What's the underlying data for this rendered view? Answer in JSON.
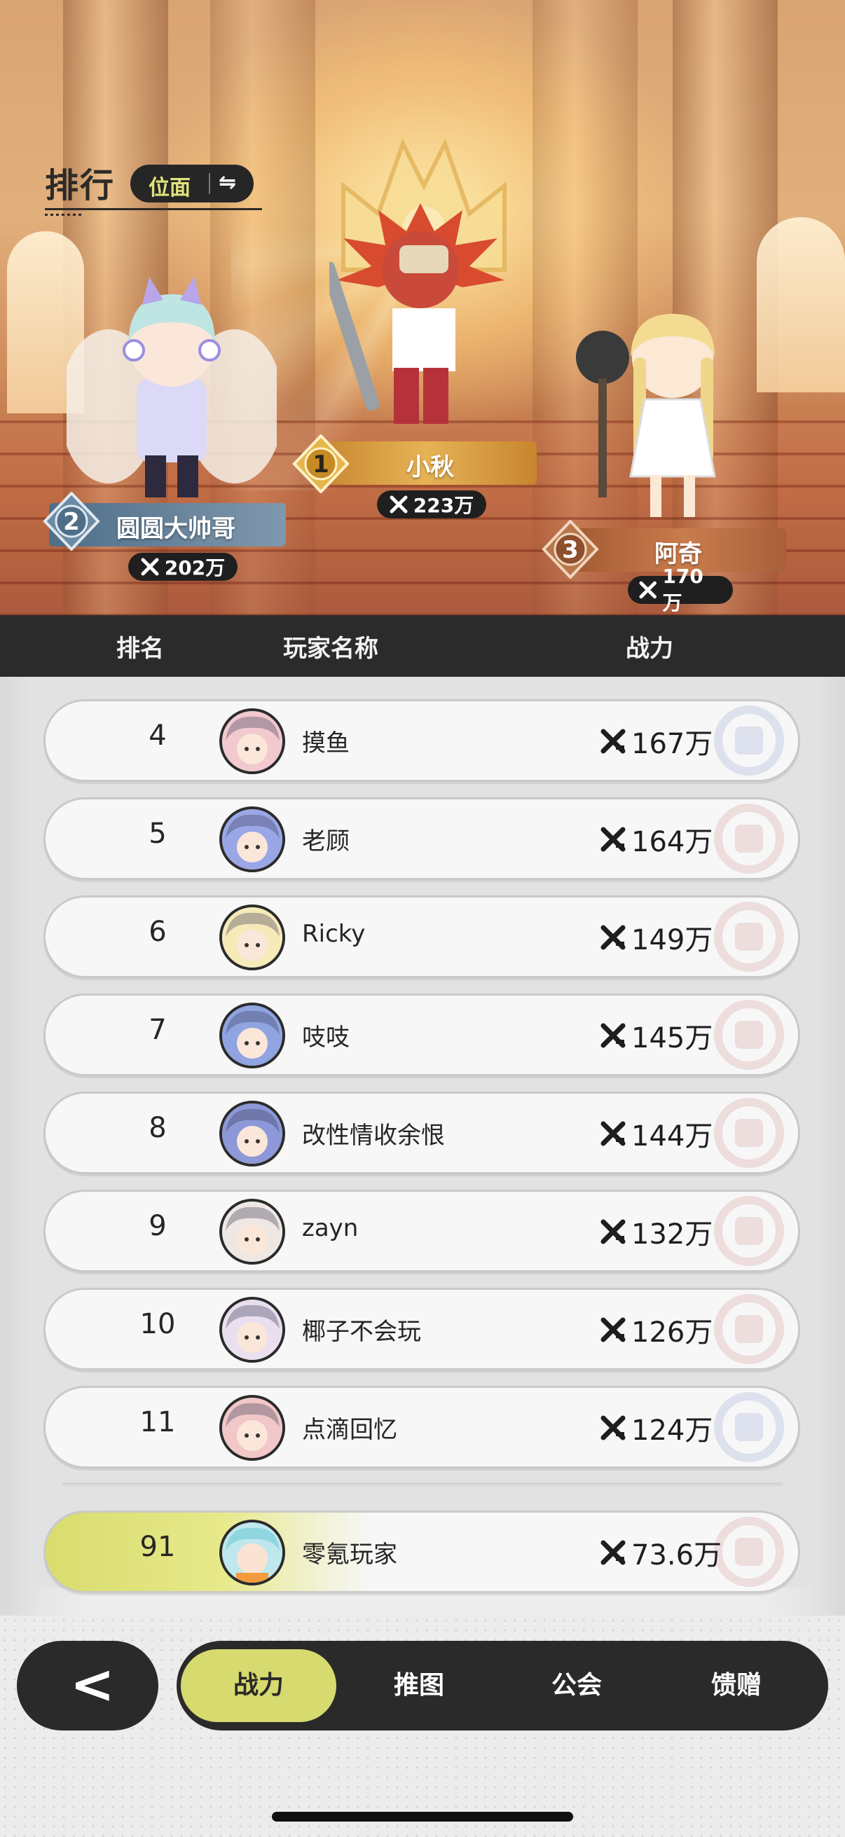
{
  "header": {
    "title": "排行",
    "switch_label": "位面",
    "switch_icon": "swap-icon"
  },
  "podium": [
    {
      "rank": "1",
      "name": "小秋",
      "power": "223万"
    },
    {
      "rank": "2",
      "name": "圆圆大帅哥",
      "power": "202万"
    },
    {
      "rank": "3",
      "name": "阿奇",
      "power": "170万"
    }
  ],
  "table": {
    "columns": [
      "排名",
      "玩家名称",
      "战力"
    ],
    "rows": [
      {
        "rank": "4",
        "name": "摸鱼",
        "power": "167万",
        "avatar_color": "#f1c9cf"
      },
      {
        "rank": "5",
        "name": "老顾",
        "power": "164万",
        "avatar_color": "#9aa7e6"
      },
      {
        "rank": "6",
        "name": "Ricky",
        "power": "149万",
        "avatar_color": "#f6eab9"
      },
      {
        "rank": "7",
        "name": "吱吱",
        "power": "145万",
        "avatar_color": "#8fa4e0"
      },
      {
        "rank": "8",
        "name": "改性情收余恨",
        "power": "144万",
        "avatar_color": "#8d98d8"
      },
      {
        "rank": "9",
        "name": "zayn",
        "power": "132万",
        "avatar_color": "#efe7e3"
      },
      {
        "rank": "10",
        "name": "椰子不会玩",
        "power": "126万",
        "avatar_color": "#e9dfee"
      },
      {
        "rank": "11",
        "name": "点滴回忆",
        "power": "124万",
        "avatar_color": "#f1c7c7"
      }
    ]
  },
  "me": {
    "rank": "91",
    "name": "零氪玩家",
    "power": "73.6万",
    "avatar_color": "#bfe8ee"
  },
  "nav": {
    "back_icon": "chevron-left-icon",
    "tabs": [
      "战力",
      "推图",
      "公会",
      "馈赠"
    ],
    "active": "战力"
  },
  "colors": {
    "accent": "#d7da6e",
    "dark": "#2a2a2a",
    "row_bg": "#f7f7f7"
  }
}
